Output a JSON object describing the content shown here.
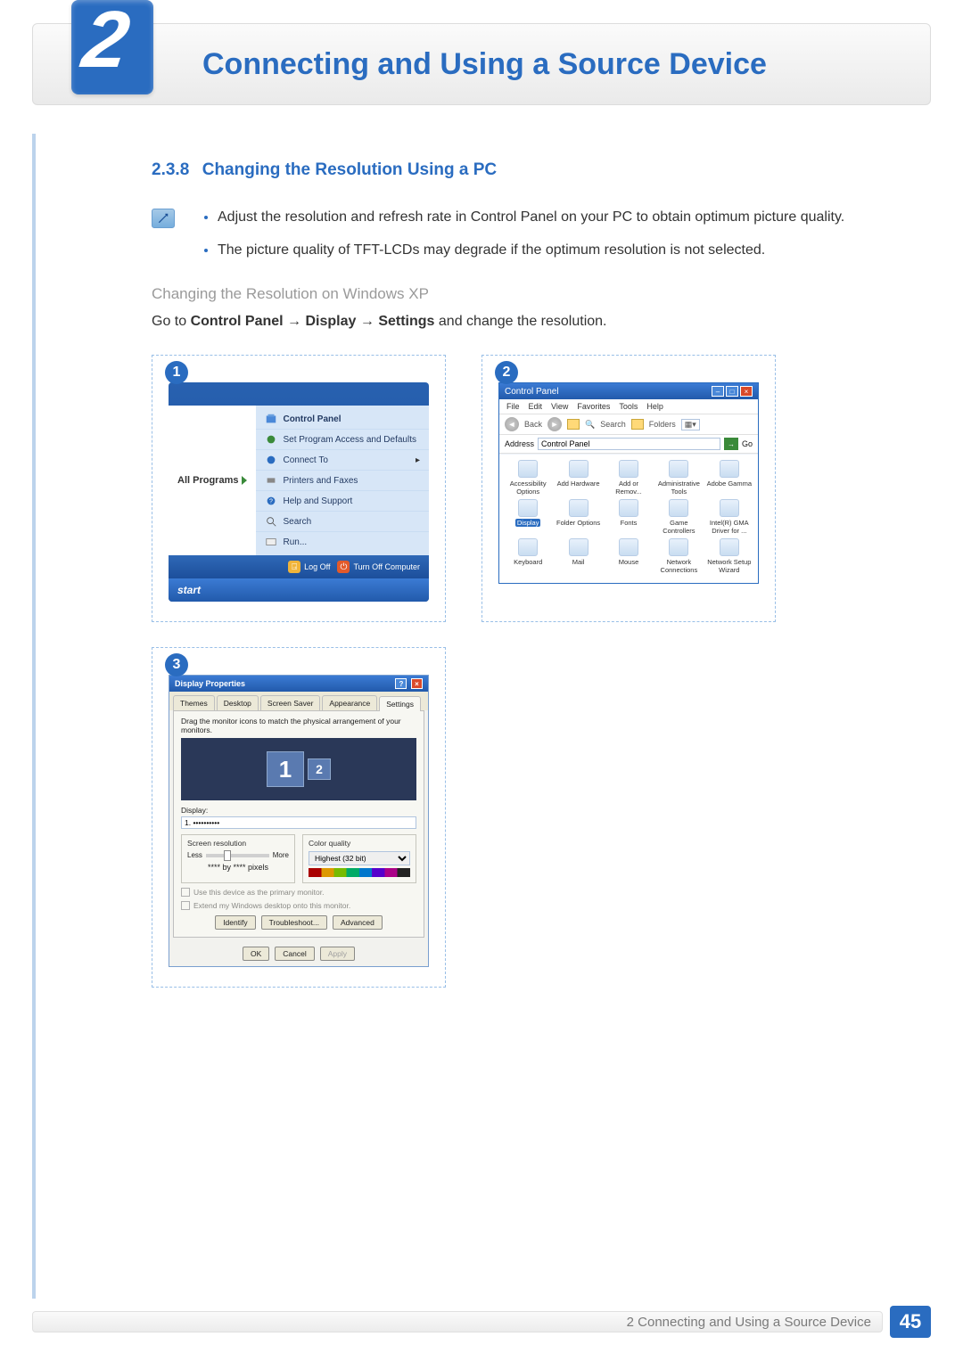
{
  "header": {
    "chapter_number": "2",
    "chapter_title": "Connecting and Using a Source Device"
  },
  "section": {
    "number": "2.3.8",
    "title": "Changing the Resolution Using a PC",
    "bullets": [
      "Adjust the resolution and refresh rate in Control Panel on your PC to obtain optimum picture quality.",
      "The picture quality of TFT-LCDs may degrade if the optimum resolution is not selected."
    ],
    "subhead": "Changing the Resolution on Windows XP",
    "path_prefix": "Go to ",
    "path_bold1": "Control Panel",
    "path_arrow": " → ",
    "path_bold2": "Display",
    "path_bold3": "Settings",
    "path_suffix": " and change the resolution."
  },
  "card1": {
    "badge": "1",
    "all_programs": "All Programs",
    "items": [
      {
        "label": "Control Panel",
        "strong": true
      },
      {
        "label": "Set Program Access and Defaults"
      },
      {
        "label": "Connect To",
        "arrow": true
      },
      {
        "label": "Printers and Faxes"
      },
      {
        "label": "Help and Support"
      },
      {
        "label": "Search"
      },
      {
        "label": "Run..."
      }
    ],
    "logoff": "Log Off",
    "turnoff": "Turn Off Computer",
    "startbar": "start"
  },
  "card2": {
    "badge": "2",
    "title": "Control Panel",
    "menus": [
      "File",
      "Edit",
      "View",
      "Favorites",
      "Tools",
      "Help"
    ],
    "back": "Back",
    "search": "Search",
    "folders": "Folders",
    "address_label": "Address",
    "address_value": "Control Panel",
    "go": "Go",
    "icons": [
      "Accessibility Options",
      "Add Hardware",
      "Add or Remov...",
      "Administrative Tools",
      "Adobe Gamma",
      "Display",
      "Folder Options",
      "Fonts",
      "Game Controllers",
      "Intel(R) GMA Driver for ...",
      "Keyboard",
      "Mail",
      "Mouse",
      "Network Connections",
      "Network Setup Wizard"
    ],
    "selected_index": 5
  },
  "card3": {
    "badge": "3",
    "title": "Display Properties",
    "tabs": [
      "Themes",
      "Desktop",
      "Screen Saver",
      "Appearance",
      "Settings"
    ],
    "active_tab": 4,
    "hint": "Drag the monitor icons to match the physical arrangement of your monitors.",
    "mon1": "1",
    "mon2": "2",
    "display_label": "Display:",
    "display_value": "1. ••••••••••",
    "sr_title": "Screen resolution",
    "less": "Less",
    "more": "More",
    "res_text": "**** by **** pixels",
    "cq_title": "Color quality",
    "cq_value": "Highest (32 bit)",
    "chk1": "Use this device as the primary monitor.",
    "chk2": "Extend my Windows desktop onto this monitor.",
    "identify": "Identify",
    "troubleshoot": "Troubleshoot...",
    "advanced": "Advanced",
    "ok": "OK",
    "cancel": "Cancel",
    "apply": "Apply"
  },
  "footer": {
    "text": "2 Connecting and Using a Source Device",
    "page_number": "45"
  }
}
